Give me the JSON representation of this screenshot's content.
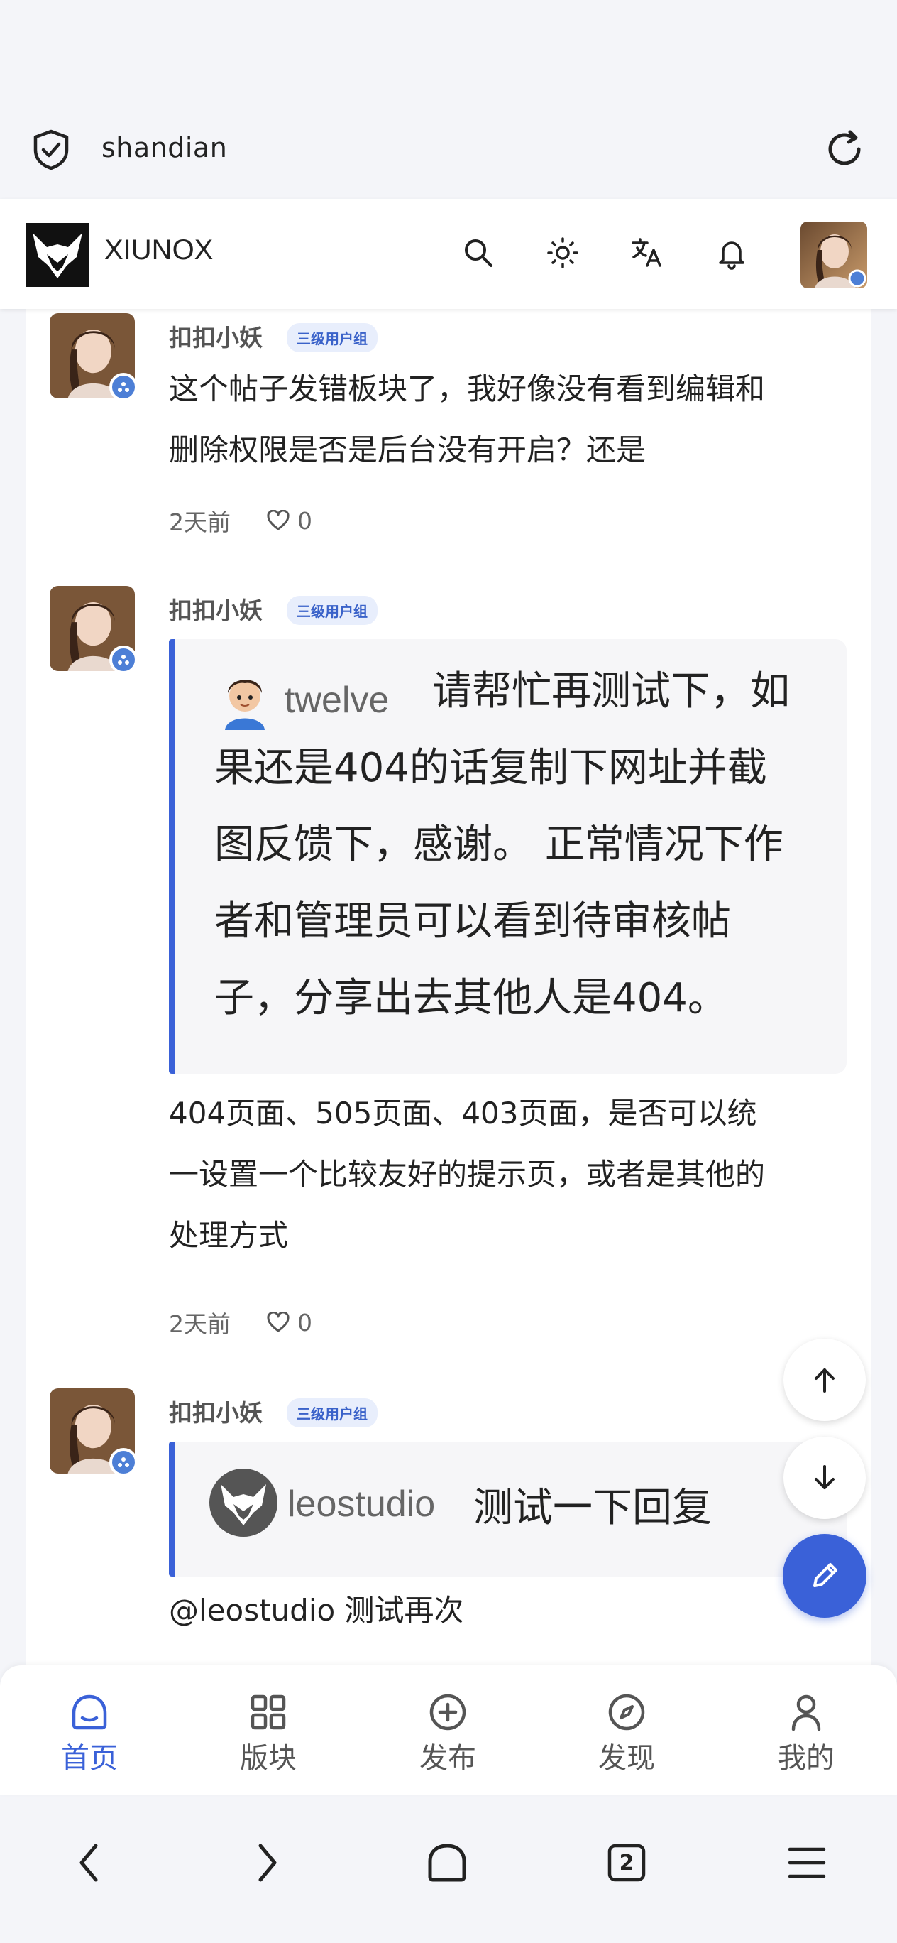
{
  "browser": {
    "url": "shandian"
  },
  "header": {
    "site_name": "XIUNOX"
  },
  "comments": [
    {
      "author": "扣扣小妖",
      "tag": "三级用户组",
      "text_lines": [
        "这个帖子发错板块了，我好像没有看到编辑和",
        "删除权限是否是后台没有开启？还是"
      ],
      "time": "2天前",
      "likes": "0"
    },
    {
      "author": "扣扣小妖",
      "tag": "三级用户组",
      "quote": {
        "user": "twelve",
        "lines": [
          "请帮忙再测试下，如",
          "果还是404的话复制下网址并截",
          "图反馈下，感谢。 正常情况下作",
          "者和管理员可以看到待审核帖",
          "子，分享出去其他人是404。"
        ]
      },
      "text_lines": [
        "404页面、505页面、403页面，是否可以统",
        "一设置一个比较友好的提示页，或者是其他的",
        "处理方式"
      ],
      "time": "2天前",
      "likes": "0"
    },
    {
      "author": "扣扣小妖",
      "tag": "三级用户组",
      "quote": {
        "user": "leostudio",
        "lines": [
          "测试一下回复"
        ]
      },
      "text_lines": [
        "@leostudio 测试再次"
      ]
    }
  ],
  "bottom_nav": [
    {
      "label": "首页",
      "icon": "home-icon",
      "active": true
    },
    {
      "label": "版块",
      "icon": "grid-icon",
      "active": false
    },
    {
      "label": "发布",
      "icon": "plus-circle-icon",
      "active": false
    },
    {
      "label": "发现",
      "icon": "compass-icon",
      "active": false
    },
    {
      "label": "我的",
      "icon": "user-icon",
      "active": false
    }
  ],
  "system_nav": {
    "tab_count": "2"
  },
  "colors": {
    "accent": "#3a61d8",
    "tag_bg": "#e8eefc",
    "page_bg": "#f4f5f9"
  }
}
